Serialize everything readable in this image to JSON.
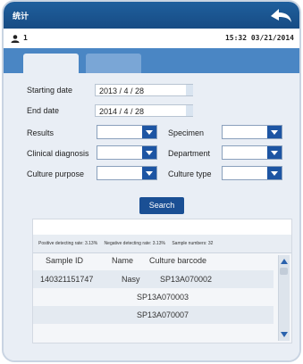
{
  "titlebar": {
    "title": "统计"
  },
  "status": {
    "user_number": "1",
    "clock": "15:32 03/21/2014"
  },
  "form": {
    "starting_date_label": "Starting date",
    "starting_date_value": "2013 / 4 / 28",
    "end_date_label": "End date",
    "end_date_value": "2014 / 4 / 28",
    "results_label": "Results",
    "specimen_label": "Specimen",
    "clinical_diagnosis_label": "Clinical diagnosis",
    "department_label": "Department",
    "culture_purpose_label": "Culture purpose",
    "culture_type_label": "Culture type",
    "search_label": "Search"
  },
  "summary": {
    "positive": "Positive detecting rate: 3.13%",
    "negative": "Negative detecting rate: 3.13%",
    "samples": "Sample numbers: 32"
  },
  "table": {
    "columns": [
      "Sample ID",
      "Name",
      "Culture barcode"
    ],
    "rows": [
      [
        "140321151747",
        "Nasy",
        "SP13A070002"
      ],
      [
        "",
        "",
        "SP13A070003"
      ],
      [
        "",
        "",
        "SP13A070007"
      ]
    ]
  },
  "colors": {
    "titlebar": "#1f5f9d",
    "accent": "#1d55a3",
    "tab_band": "#4a86c4"
  }
}
